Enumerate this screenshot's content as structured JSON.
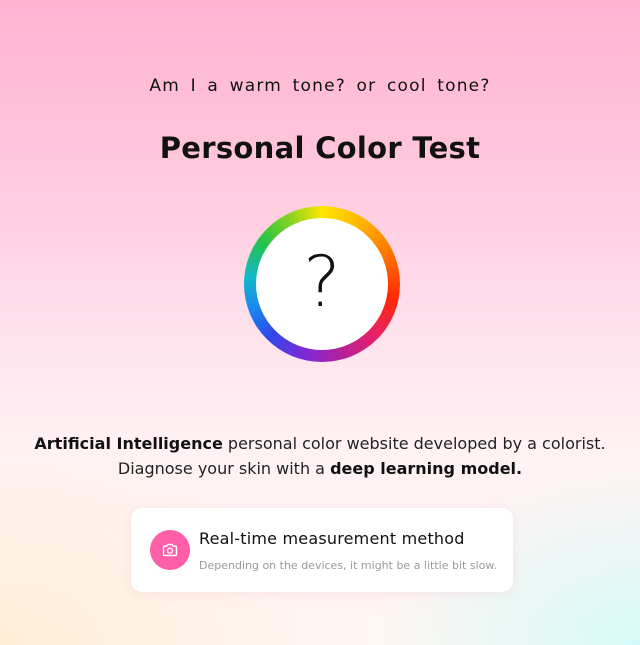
{
  "header": {
    "subtitle": "Am I a warm tone? or cool tone?",
    "title": "Personal Color Test"
  },
  "hero": {
    "question_mark": "?"
  },
  "description": {
    "line1_bold": "Artificial Intelligence",
    "line1_rest": " personal color website developed by a colorist.",
    "line2_start": "Diagnose your skin with a ",
    "line2_bold": "deep learning model."
  },
  "method_card": {
    "icon": "camera-icon",
    "title": "Real-time measurement method",
    "subtitle": "Depending on the devices, it might be a little bit slow."
  },
  "colors": {
    "accent_pink": "#ff5fa8",
    "text": "#111111",
    "muted": "#9a9a9a"
  }
}
